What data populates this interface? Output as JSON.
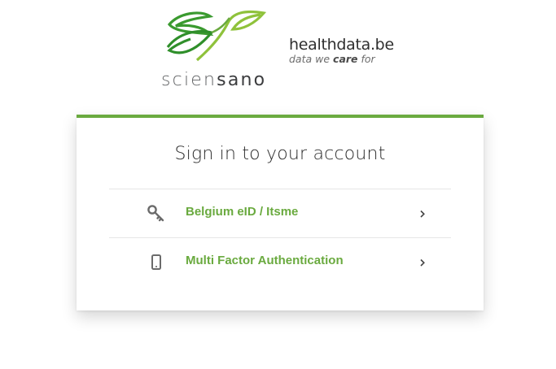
{
  "brand": {
    "sciensano_part1": "scien",
    "sciensano_part2": "sano",
    "healthdata_name": "healthdata.be",
    "tagline_pre": "data we ",
    "tagline_em": "care",
    "tagline_post": " for",
    "leaf_colors": [
      "#3a9a2f",
      "#a8cf3a"
    ]
  },
  "card": {
    "title": "Sign in to your account",
    "accent_color": "#6aaa3f",
    "options": [
      {
        "label": "Belgium eID / Itsme",
        "icon": "key-icon"
      },
      {
        "label": "Multi Factor Authentication",
        "icon": "mobile-phone-icon"
      }
    ]
  }
}
